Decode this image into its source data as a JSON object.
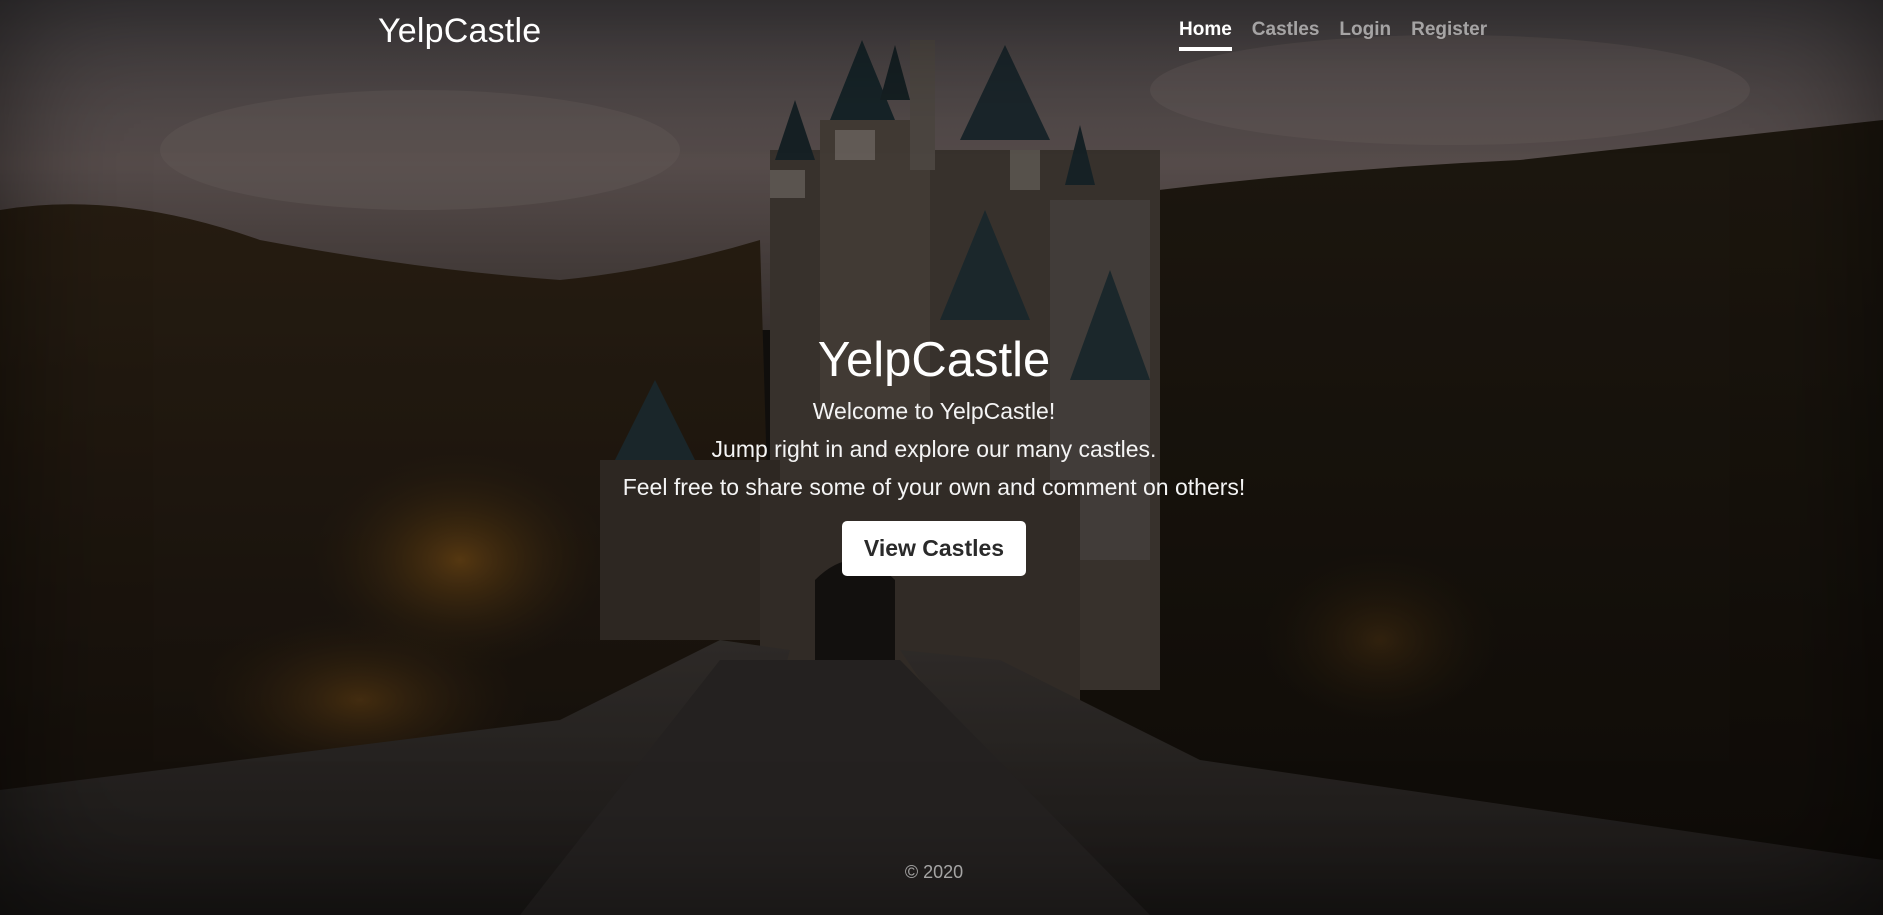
{
  "header": {
    "brand": "YelpCastle",
    "nav": [
      {
        "label": "Home",
        "active": true
      },
      {
        "label": "Castles",
        "active": false
      },
      {
        "label": "Login",
        "active": false
      },
      {
        "label": "Register",
        "active": false
      }
    ]
  },
  "hero": {
    "title": "YelpCastle",
    "lines": [
      "Welcome to YelpCastle!",
      "Jump right in and explore our many castles.",
      "Feel free to share some of your own and comment on others!"
    ],
    "button_label": "View Castles"
  },
  "footer": {
    "copyright": "© 2020"
  },
  "colors": {
    "overlay": "#000000",
    "text": "#ffffff",
    "nav_inactive": "#9a9a9a",
    "button_bg": "#ffffff",
    "button_text": "#2a2a2a"
  }
}
